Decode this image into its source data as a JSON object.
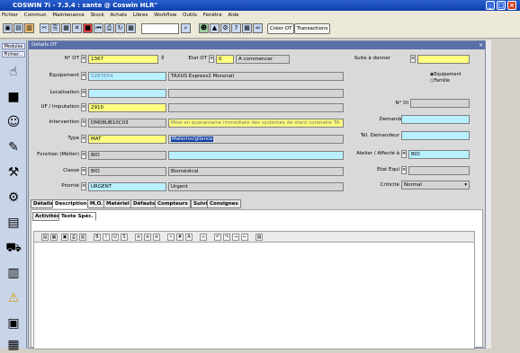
{
  "window": {
    "title": "COSWIN 7i - 7.3.4 : sante @  Coswin HLR\""
  },
  "menu": [
    "Fichier",
    "Commun",
    "Maintenance",
    "Stock",
    "Achats",
    "Libres",
    "Workflow",
    "Outils",
    "Fenêtre",
    "Aide"
  ],
  "toolbar": {
    "create_ot_label": "Créer OT",
    "transactions_label": "Transactions"
  },
  "sidebar": {
    "modules_label": "Modules",
    "fichier_label": "Fichier..."
  },
  "panel": {
    "title": "Détails OT",
    "fields": {
      "no_ot": {
        "label": "N° OT",
        "value": "1367"
      },
      "etat_ot": {
        "label": "Etat OT",
        "code": "0",
        "text": "A commencer"
      },
      "suite_a_donner": {
        "label": "Suite à donner",
        "value": ""
      },
      "equipement": {
        "label": "Equipement",
        "code": "0287654",
        "text": "TAXUS Express2 Monorail"
      },
      "localisation": {
        "label": "Localisation",
        "code": "",
        "text": ""
      },
      "ui_imputation": {
        "label": "UF / Imputation",
        "code": "2910",
        "text": ""
      },
      "no_di": {
        "label": "N° DI",
        "value": ""
      },
      "intervention": {
        "label": "Intervention",
        "code": "DM08UB10C03",
        "text": "Mise en quarantaine immédiate des systèmes de stent coronaire TA"
      },
      "demandeur": {
        "label": "Demandeur",
        "value": ""
      },
      "type": {
        "label": "Type",
        "code": "MAT",
        "text": "Matériovigilance"
      },
      "tel_demandeur": {
        "label": "Tél. Demandeur",
        "value": ""
      },
      "fonction": {
        "label": "Fonction (Métier)",
        "code": "BIO",
        "text": ""
      },
      "atelier": {
        "label": "Atelier / Affecté à",
        "value": "BIO"
      },
      "classe": {
        "label": "Classe",
        "code": "BIO",
        "text": "Biomédical"
      },
      "etat_equi": {
        "label": "Etat Equi",
        "value": ""
      },
      "priorite": {
        "label": "Priorité",
        "code": "URGENT",
        "text": "Urgent"
      },
      "criticite": {
        "label": "Criticité",
        "value": "Normal"
      }
    },
    "radios": [
      "Equipement",
      "Famille"
    ],
    "tabs": [
      "Détails",
      "Description",
      "M.O.",
      "Matériel",
      "Défauts",
      "Compteurs",
      "Suivi",
      "Consignes"
    ],
    "subtabs": [
      "Activités",
      "Texte Spéc."
    ]
  },
  "editor_buttons": [
    "new-icon",
    "open-icon",
    "save-icon",
    "print-icon",
    "preview-icon",
    "bold-icon",
    "italic-icon",
    "underline-icon",
    "strike-icon",
    "align-left-icon",
    "align-center-icon",
    "align-right-icon",
    "bullets-icon",
    "numbering-icon",
    "color-icon",
    "link-icon",
    "undo-icon",
    "redo-icon",
    "indent-icon",
    "outdent-icon",
    "image-icon"
  ]
}
